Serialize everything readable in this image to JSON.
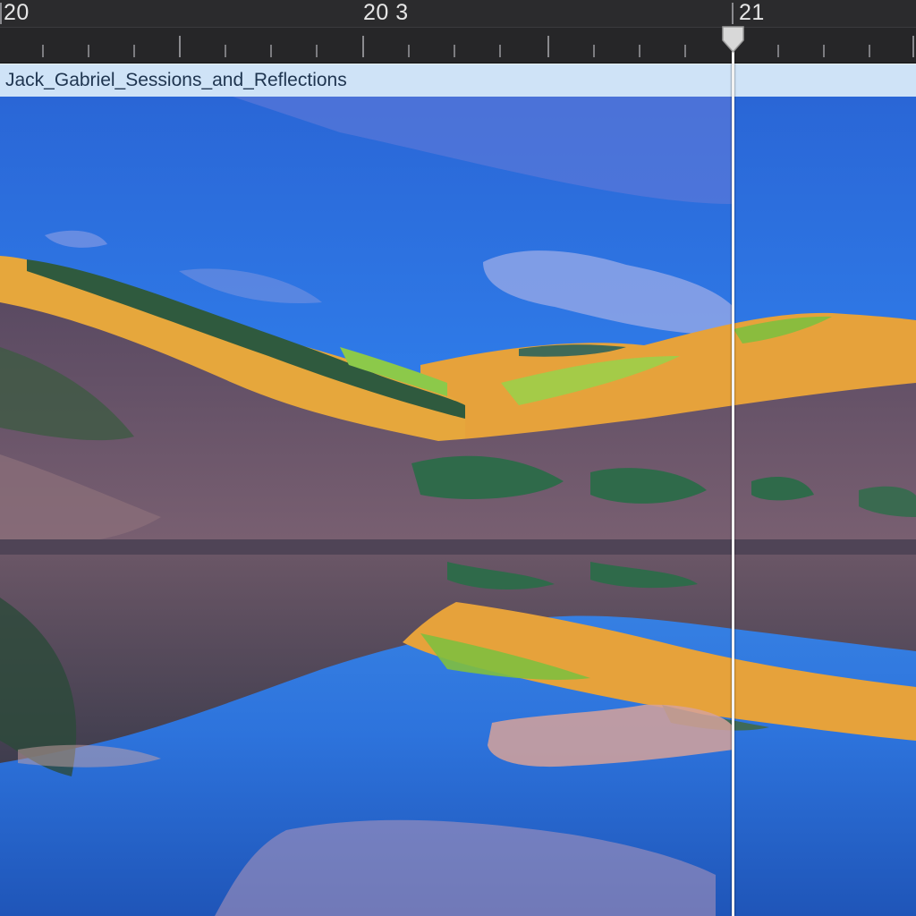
{
  "timeline": {
    "ruler_labels": [
      {
        "id": "label-20",
        "text": "20"
      },
      {
        "id": "label-20-3",
        "text": "20 3"
      },
      {
        "id": "label-21",
        "text": "21"
      }
    ]
  },
  "clip": {
    "title": "Jack_Gabriel_Sessions_and_Reflections",
    "thumbnail_icon": "landscape-lake-reflection-image"
  },
  "playhead": {
    "icon": "playhead-handle-icon"
  },
  "colors": {
    "ruler_background": "#2b2b2d",
    "clip_header_background": "#cfe3f7",
    "clip_title_text": "#1f3550",
    "playhead": "#f2f2f2",
    "sky_blue": "#2f76e8",
    "hill_gold": "#e2a23a",
    "forest_purple": "#6a5270"
  }
}
